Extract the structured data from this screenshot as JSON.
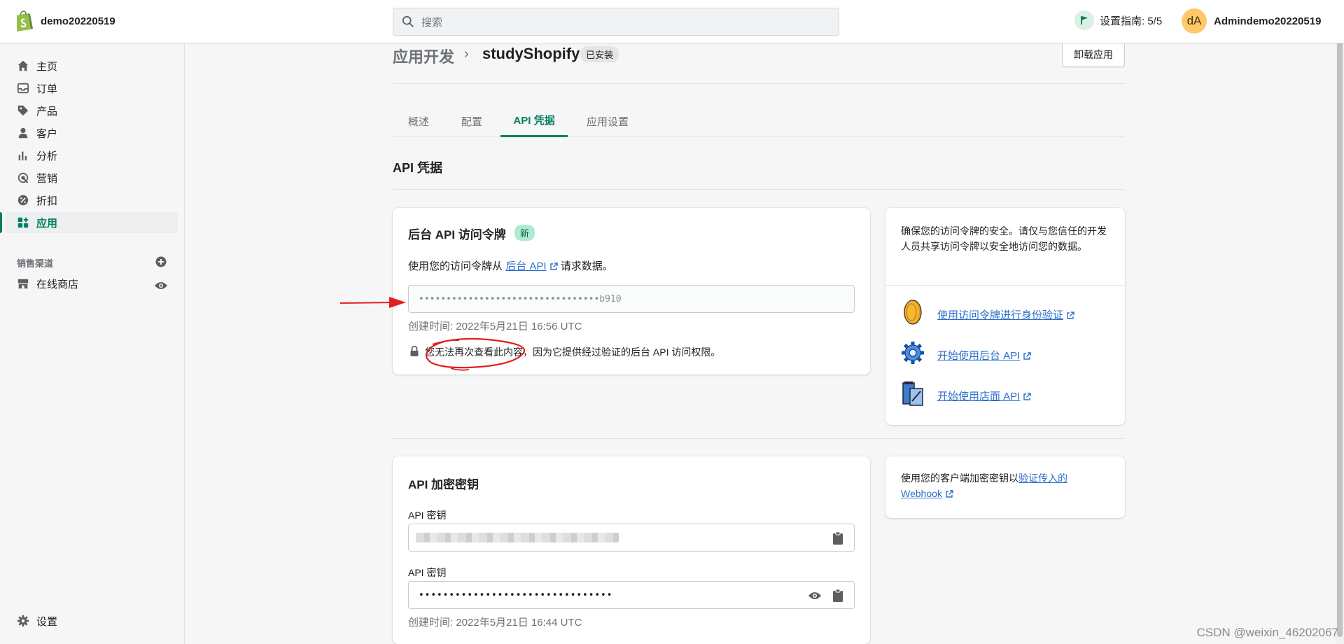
{
  "topbar": {
    "store_name": "demo20220519",
    "search_placeholder": "搜索",
    "setup_guide": "设置指南: 5/5",
    "avatar_initials": "dA",
    "user_name": "Admindemo20220519"
  },
  "sidebar": {
    "items": [
      {
        "label": "主页",
        "icon": "home-icon"
      },
      {
        "label": "订单",
        "icon": "orders-icon"
      },
      {
        "label": "产品",
        "icon": "tag-icon"
      },
      {
        "label": "客户",
        "icon": "person-icon"
      },
      {
        "label": "分析",
        "icon": "analytics-icon"
      },
      {
        "label": "营销",
        "icon": "marketing-icon"
      },
      {
        "label": "折扣",
        "icon": "discount-icon"
      },
      {
        "label": "应用",
        "icon": "apps-icon",
        "active": true
      }
    ],
    "sales_channels_label": "销售渠道",
    "online_store": "在线商店",
    "settings": "设置"
  },
  "header": {
    "breadcrumb_parent": "应用开发",
    "breadcrumb_sep": "›",
    "title": "studyShopify",
    "badge": "已安装",
    "uninstall": "卸载应用"
  },
  "tabs": [
    "概述",
    "配置",
    "API 凭据",
    "应用设置"
  ],
  "active_tab": "API 凭据",
  "main": {
    "section_title": "API 凭据",
    "admin_token": {
      "title": "后台 API 访问令牌",
      "badge": "新",
      "desc_prefix": "使用您的访问令牌从",
      "desc_link": "后台 API",
      "desc_suffix": "请求数据。",
      "token_value": "•••••••••••••••••••••••••••••••••b910",
      "created": "创建时间: 2022年5月21日 16:56 UTC",
      "warning": "您无法再次查看此内容，因为它提供经过验证的后台 API 访问权限。"
    },
    "security_card": {
      "text": "确保您的访问令牌的安全。请仅与您信任的开发人员共享访问令牌以安全地访问您的数据。",
      "links": [
        {
          "label": "使用访问令牌进行身份验证",
          "icon": "coin-icon"
        },
        {
          "label": "开始使用后台 API",
          "icon": "gear-icon"
        },
        {
          "label": "开始使用店面 API",
          "icon": "storefront-icon"
        }
      ]
    },
    "api_keys": {
      "title": "API 加密密钥",
      "key_label": "API 密钥",
      "secret_label": "API 密钥",
      "secret_value": "••••••••••••••••••••••••••••••••",
      "created": "创建时间: 2022年5月21日 16:44 UTC"
    },
    "webhook_card": {
      "text_prefix": "使用您的客户端加密密钥以",
      "link": "验证传入的 Webhook"
    }
  },
  "watermark": "CSDN @weixin_46202067",
  "colors": {
    "accent": "#008060",
    "link": "#2c6ecb",
    "annotation": "#e02020"
  }
}
